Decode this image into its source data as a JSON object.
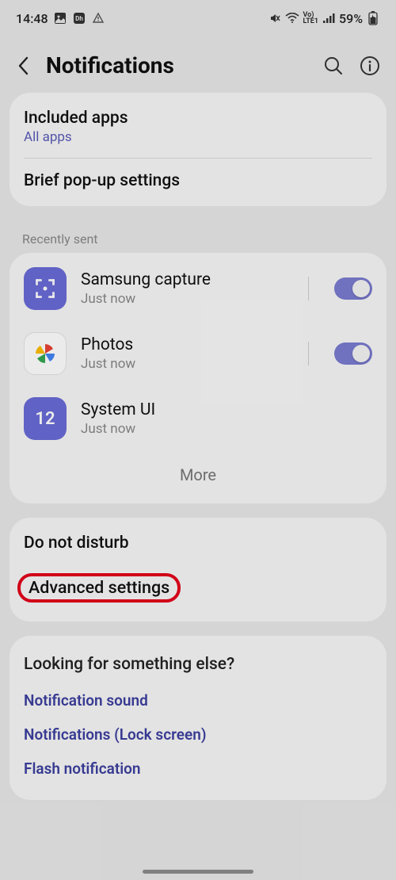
{
  "status": {
    "time": "14:48",
    "battery": "59%"
  },
  "header": {
    "title": "Notifications"
  },
  "card1": {
    "included_title": "Included apps",
    "included_sub": "All apps",
    "brief_title": "Brief pop-up settings"
  },
  "recent": {
    "label": "Recently sent",
    "apps": [
      {
        "name": "Samsung capture",
        "time": "Just now"
      },
      {
        "name": "Photos",
        "time": "Just now"
      },
      {
        "name": "System UI",
        "time": "Just now"
      }
    ],
    "more": "More"
  },
  "card3": {
    "dnd": "Do not disturb",
    "advanced": "Advanced settings"
  },
  "looking": {
    "title": "Looking for something else?",
    "links": [
      "Notification sound",
      "Notifications (Lock screen)",
      "Flash notification"
    ]
  }
}
